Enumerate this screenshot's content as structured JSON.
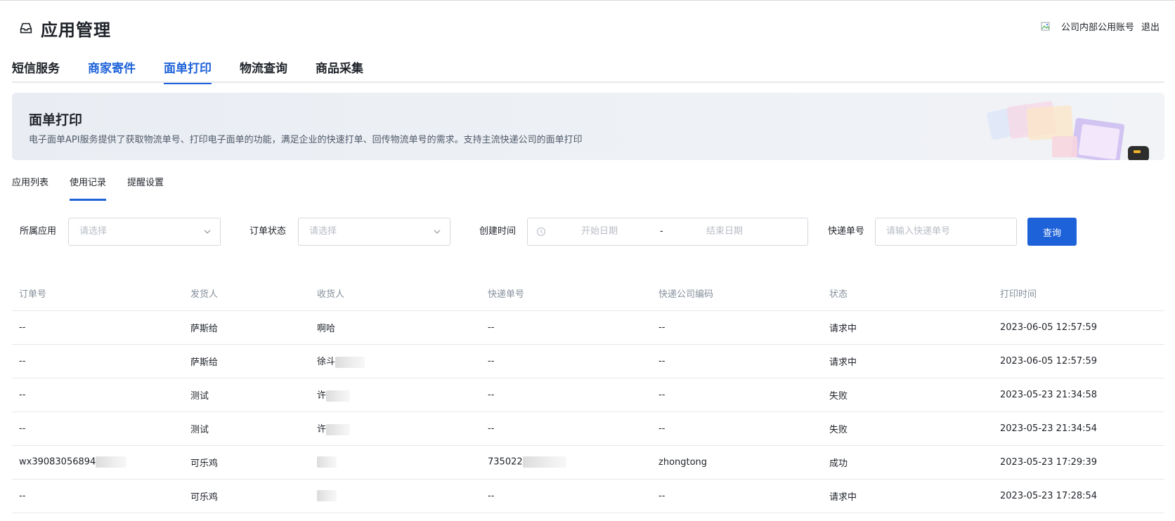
{
  "header": {
    "title": "应用管理"
  },
  "user": {
    "account": "公司内部公用账号",
    "logout": "退出"
  },
  "main_tabs": [
    {
      "label": "短信服务"
    },
    {
      "label": "商家寄件"
    },
    {
      "label": "面单打印"
    },
    {
      "label": "物流查询"
    },
    {
      "label": "商品采集"
    }
  ],
  "banner": {
    "title": "面单打印",
    "description": "电子面单API服务提供了获取物流单号、打印电子面单的功能，满足企业的快速打单、回传物流单号的需求。支持主流快递公司的面单打印"
  },
  "sub_tabs": [
    {
      "label": "应用列表"
    },
    {
      "label": "使用记录"
    },
    {
      "label": "提醒设置"
    }
  ],
  "filters": {
    "app_label": "所属应用",
    "app_placeholder": "请选择",
    "status_label": "订单状态",
    "status_placeholder": "请选择",
    "time_label": "创建时间",
    "start_placeholder": "开始日期",
    "separator": "-",
    "end_placeholder": "结束日期",
    "tracking_label": "快递单号",
    "tracking_placeholder": "请输入快递单号",
    "query_button": "查询"
  },
  "table": {
    "columns": [
      "订单号",
      "发货人",
      "收货人",
      "快递单号",
      "快递公司编码",
      "状态",
      "打印时间"
    ],
    "rows": [
      {
        "order": "--",
        "sender": "萨斯给",
        "receiver": "啊哈",
        "tracking": "--",
        "carrier": "--",
        "status": "请求中",
        "time": "2023-06-05 12:57:59"
      },
      {
        "order": "--",
        "sender": "萨斯给",
        "receiver": "徐斗",
        "tracking": "--",
        "carrier": "--",
        "status": "请求中",
        "time": "2023-06-05 12:57:59"
      },
      {
        "order": "--",
        "sender": "测试",
        "receiver": "许",
        "tracking": "--",
        "carrier": "--",
        "status": "失败",
        "time": "2023-05-23 21:34:58"
      },
      {
        "order": "--",
        "sender": "测试",
        "receiver": "许",
        "tracking": "--",
        "carrier": "--",
        "status": "失败",
        "time": "2023-05-23 21:34:54"
      },
      {
        "order": "wx39083056894",
        "sender": "可乐鸡",
        "receiver": "",
        "tracking": "735022",
        "carrier": "zhongtong",
        "status": "成功",
        "time": "2023-05-23 17:29:39"
      },
      {
        "order": "--",
        "sender": "可乐鸡",
        "receiver": "",
        "tracking": "--",
        "carrier": "--",
        "status": "请求中",
        "time": "2023-05-23 17:28:54"
      }
    ]
  }
}
